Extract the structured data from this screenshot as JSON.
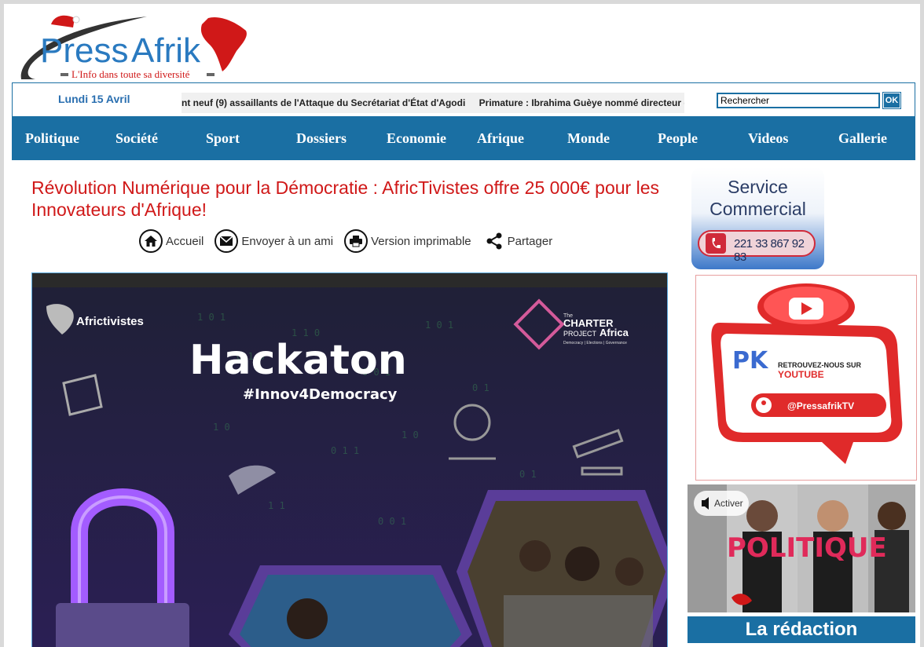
{
  "brand": {
    "name_part1": "Press",
    "name_part2": "Afrik",
    "tagline": "L'Info dans toute sa diversité",
    "colors": {
      "blue": "#1a6fa3",
      "red": "#d01818"
    }
  },
  "topbar": {
    "date": "Lundi 15 Avril",
    "ticker": [
      "nt neuf (9) assaillants de l'Attaque du Secrétariat d'État d'Agodi",
      "Primature : Ibrahima Guèye nommé directeur d"
    ],
    "search": {
      "placeholder": "Rechercher",
      "button_label": "OK"
    }
  },
  "nav": {
    "items": [
      "Politique",
      "Société",
      "Sport",
      "Dossiers",
      "Economie",
      "Afrique",
      "Monde",
      "People",
      "Videos",
      "Gallerie"
    ]
  },
  "article": {
    "title": "Révolution Numérique pour la Démocratie : AfricTivistes offre 25 000€ pour les Innovateurs d'Afrique!",
    "actions": {
      "home": {
        "label": "Accueil",
        "icon": "home-icon"
      },
      "email": {
        "label": "Envoyer à un ami",
        "icon": "envelope-icon"
      },
      "print": {
        "label": "Version imprimable",
        "icon": "printer-icon"
      },
      "share": {
        "label": "Partager",
        "icon": "share-icon"
      }
    },
    "hero": {
      "brand_left": "Africtivistes",
      "brand_right_line1": "The",
      "brand_right_line2": "CHARTER",
      "brand_right_line3": "PROJECT",
      "brand_right_line4": "Africa",
      "brand_right_line5": "Democracy | Elections | Governance",
      "headline": "Hackaton",
      "hashtag": "#Innov4Democracy"
    }
  },
  "sidebar": {
    "service": {
      "line1": "Service",
      "line2": "Commercial",
      "phone": "221 33 867 92 83"
    },
    "youtube": {
      "logo": "PK",
      "line1": "RETROUVEZ-NOUS SUR",
      "line2": "YOUTUBE",
      "handle": "@PressafrikTV"
    },
    "video": {
      "unmute": "Activer",
      "caption": "POLITIQUE"
    },
    "redaction_title": "La rédaction"
  }
}
